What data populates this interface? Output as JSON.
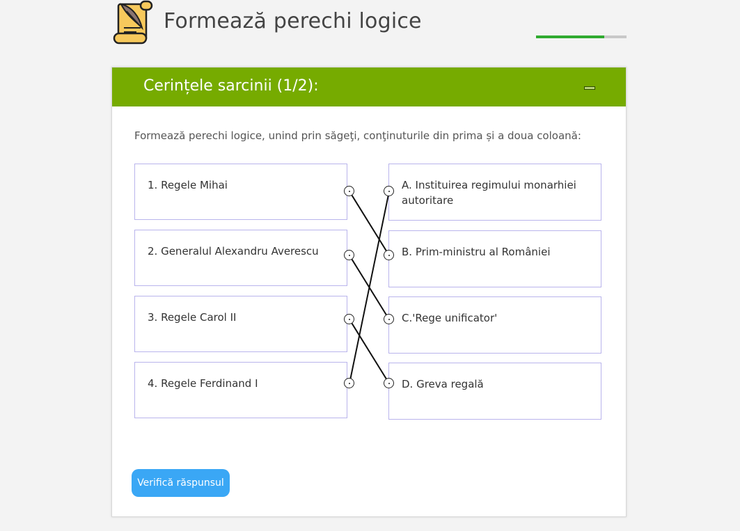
{
  "header": {
    "title": "Formează perechi logice",
    "logo_icon": "scroll-quill-icon",
    "progress": 0.75,
    "progress_color": "#2faa2f"
  },
  "card": {
    "title": "Cerințele sarcinii (1/2):",
    "header_color": "#76ab00",
    "collapse_icon": "minus-icon",
    "instruction": "Formează perechi logice, unind prin săgeţi, conţinuturile din prima și a doua coloană:",
    "left_items": [
      {
        "label": "1. Regele Mihai"
      },
      {
        "label": "2. Generalul Alexandru Averescu"
      },
      {
        "label": "3. Regele Carol II"
      },
      {
        "label": "4. Regele Ferdinand I"
      }
    ],
    "right_items": [
      {
        "label": "A. Instituirea regimului monarhiei autoritare"
      },
      {
        "label": "B. Prim-ministru al României"
      },
      {
        "label": "C.'Rege unificator'"
      },
      {
        "label": "D. Greva regală"
      }
    ],
    "connections": [
      {
        "from": 0,
        "to": 1
      },
      {
        "from": 1,
        "to": 2
      },
      {
        "from": 2,
        "to": 3
      },
      {
        "from": 3,
        "to": 0
      }
    ],
    "verify_button": "Verifică răspunsul",
    "verify_color": "#3aa7f5"
  }
}
